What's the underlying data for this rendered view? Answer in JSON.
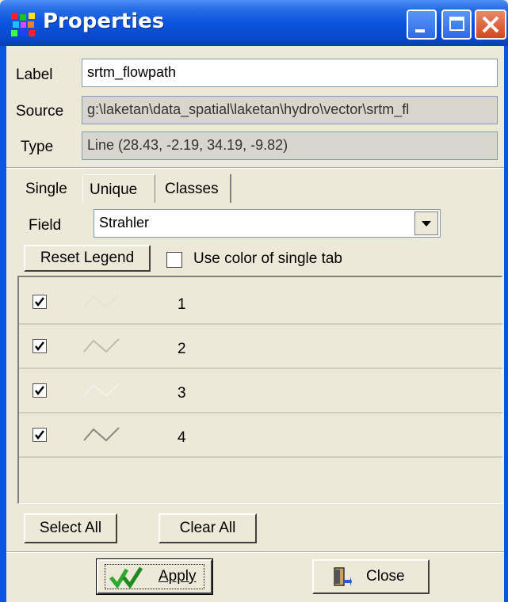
{
  "window": {
    "title": "Properties",
    "icon": "app-grid-icon"
  },
  "info": {
    "label_label": "Label",
    "label_value": "srtm_flowpath",
    "source_label": "Source",
    "source_value": "g:\\laketan\\data_spatial\\laketan\\hydro\\vector\\srtm_fl",
    "type_label": "Type",
    "type_value": "Line   (28.43, -2.19, 34.19, -9.82)"
  },
  "tabs": [
    {
      "label": "Single"
    },
    {
      "label": "Unique"
    },
    {
      "label": "Classes"
    }
  ],
  "field": {
    "label": "Field",
    "selected": "Strahler"
  },
  "reset_legend": "Reset Legend",
  "use_color_label": "Use color of single tab",
  "legend_rows": [
    {
      "value": "1",
      "checked": true,
      "symbol_color": "#e6e4da"
    },
    {
      "value": "2",
      "checked": true,
      "symbol_color": "#bdbab0"
    },
    {
      "value": "3",
      "checked": true,
      "symbol_color": "#f2f1ea"
    },
    {
      "value": "4",
      "checked": true,
      "symbol_color": "#8a877e"
    }
  ],
  "select_all": "Select All",
  "clear_all": "Clear All",
  "apply": "Apply",
  "close": "Close",
  "colors": {
    "titlebar": "#0a55e0",
    "dialog_bg": "#ece9d8",
    "apply_check": "#2ea82e"
  }
}
